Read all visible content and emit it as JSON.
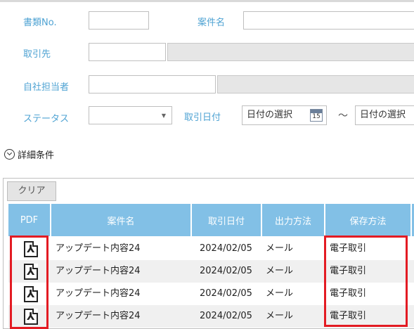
{
  "form": {
    "doc_no_label": "書類No.",
    "case_name_label": "案件名",
    "client_label": "取引先",
    "own_person_label": "自社担当者",
    "status_label": "ステータス",
    "trade_date_label": "取引日付",
    "date_from_placeholder": "日付の選択",
    "date_to_placeholder": "日付の選択",
    "calendar_day": "15",
    "range_separator": "〜",
    "detail_toggle": "詳細条件"
  },
  "toolbar": {
    "clear_label": "クリア"
  },
  "table": {
    "columns": [
      "PDF",
      "案件名",
      "取引日付",
      "出力方法",
      "保存方法"
    ],
    "rows": [
      {
        "case": "アップデート内容24",
        "date": "2024/02/05",
        "output": "メール",
        "storage": "電子取引"
      },
      {
        "case": "アップデート内容24",
        "date": "2024/02/05",
        "output": "メール",
        "storage": "電子取引"
      },
      {
        "case": "アップデート内容24",
        "date": "2024/02/05",
        "output": "メール",
        "storage": "電子取引"
      },
      {
        "case": "アップデート内容24",
        "date": "2024/02/05",
        "output": "メール",
        "storage": "電子取引"
      }
    ]
  },
  "colors": {
    "label": "#4fa3d3",
    "header_bg": "#82c0e6",
    "highlight": "#e31b23"
  },
  "icons": {
    "pdf": "pdf-file-icon",
    "calendar": "calendar-icon",
    "detail": "chevron-circle-down-icon"
  }
}
